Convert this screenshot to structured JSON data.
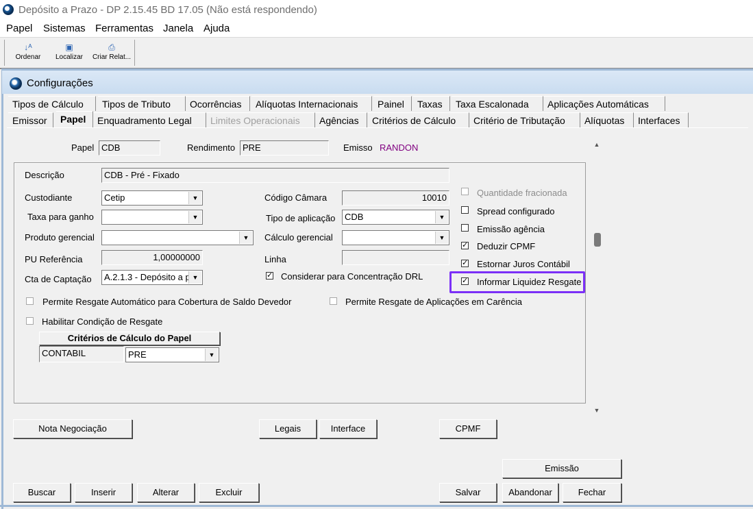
{
  "window": {
    "title": "Depósito a Prazo -  DP 2.15.45 BD 17.05 (Não está respondendo)"
  },
  "menu": [
    "Papel",
    "Sistemas",
    "Ferramentas",
    "Janela",
    "Ajuda"
  ],
  "toolbar": {
    "ordenar": "Ordenar",
    "localizar": "Localizar",
    "criar": "Criar Relat..."
  },
  "child": {
    "title": "Configurações"
  },
  "tabs_row1": [
    "Tipos de Cálculo",
    "Tipos de Tributo",
    "Ocorrências",
    "Alíquotas Internacionais",
    "Painel",
    "Taxas",
    "Taxa Escalonada",
    "Aplicações Automáticas"
  ],
  "tabs_row2": [
    "Emissor",
    "Papel",
    "Enquadramento Legal",
    "Limites Operacionais",
    "Agências",
    "Critérios de Cálculo",
    "Critério de Tributação",
    "Alíquotas",
    "Interfaces"
  ],
  "header": {
    "papel_label": "Papel",
    "papel_value": "CDB",
    "rend_label": "Rendimento",
    "rend_value": "PRE",
    "emissor_label": "Emisso",
    "emissor_value": "RANDON"
  },
  "form": {
    "descricao_label": "Descrição",
    "descricao_value": "CDB - Pré - Fixado",
    "custodiante_label": "Custodiante",
    "custodiante_value": "Cetip",
    "taxa_label": "Taxa para ganho",
    "taxa_value": "",
    "produto_label": "Produto gerencial",
    "produto_value": "",
    "pu_label": "PU Referência",
    "pu_value": "1,00000000",
    "cta_label": "Cta de Captação",
    "cta_value": "A.2.1.3 - Depósito a p",
    "codigo_label": "Código Câmara",
    "codigo_value": "10010",
    "tipo_label": "Tipo de aplicação",
    "tipo_value": "CDB",
    "calculo_label": "Cálculo gerencial",
    "calculo_value": "",
    "linha_label": "Linha",
    "linha_value": ""
  },
  "checks": {
    "qtd": "Quantidade fracionada",
    "spread": "Spread configurado",
    "emissao": "Emissão agência",
    "cpmf": "Deduzir CPMF",
    "juros": "Estornar Juros Contábil",
    "liquidez": "Informar Liquidez Resgate",
    "drl": "Considerar para Concentração DRL",
    "resgate_auto": "Permite Resgate Automático para Cobertura de Saldo Devedor",
    "resgate_carencia": "Permite Resgate de Aplicações em Carência",
    "habilitar": "Habilitar Condição de Resgate"
  },
  "criterios": {
    "header": "Critérios de Cálculo do Papel",
    "col1": "CONTABIL",
    "col2": "PRE"
  },
  "buttons": {
    "nota": "Nota Negociação",
    "legais": "Legais",
    "interface": "Interface",
    "cpmf": "CPMF",
    "emissao": "Emissão",
    "buscar": "Buscar",
    "inserir": "Inserir",
    "alterar": "Alterar",
    "excluir": "Excluir",
    "salvar": "Salvar",
    "abandonar": "Abandonar",
    "fechar": "Fechar"
  },
  "colors": {
    "highlight": "#7b2ff7",
    "emissor_value": "#800080"
  }
}
